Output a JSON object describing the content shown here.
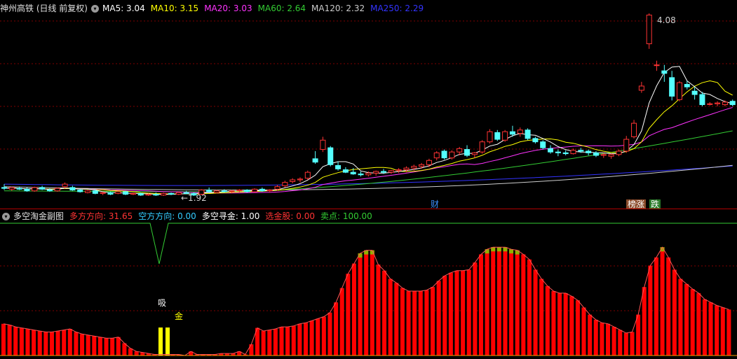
{
  "main_panel": {
    "title": "神州高铁 (日线 前复权)",
    "ma_legend": [
      {
        "label": "MA5: 3.04",
        "color": "#ffffff"
      },
      {
        "label": "MA10: 3.15",
        "color": "#ffff00"
      },
      {
        "label": "MA20: 3.03",
        "color": "#ff33ff"
      },
      {
        "label": "MA60: 2.64",
        "color": "#33cc33"
      },
      {
        "label": "MA120: 2.32",
        "color": "#cccccc"
      },
      {
        "label": "MA250: 2.29",
        "color": "#3333ff"
      }
    ],
    "high_label": "4.08",
    "low_label": "←1.92",
    "event_labels": [
      {
        "text": "财",
        "color": "#3a8fff",
        "bg": ""
      },
      {
        "text": "榜涨",
        "color": "#ffffff",
        "bg": "#8a4a2a"
      },
      {
        "text": "跌",
        "color": "#ffffff",
        "bg": "#2a7a2a"
      }
    ]
  },
  "sub_panel": {
    "title": "多空淘金副图",
    "legend": [
      {
        "label": "多方方向: 31.65",
        "color": "#ff3333"
      },
      {
        "label": "空方方向: 0.00",
        "color": "#33ccff"
      },
      {
        "label": "多空寻金: 1.00",
        "color": "#ffffff"
      },
      {
        "label": "选金股: 0.00",
        "color": "#ff3333"
      },
      {
        "label": "卖点: 100.00",
        "color": "#33cc33"
      }
    ],
    "signal_labels": [
      {
        "text": "吸",
        "color": "#ffffff"
      },
      {
        "text": "金",
        "color": "#ffff00"
      }
    ]
  },
  "colors": {
    "background": "#000000",
    "grid": "#800000",
    "up_candle": "#ff3333",
    "down_candle": "#54ffff",
    "bar": "#ff0000",
    "bar_top": "#90b000",
    "signal_bar": "#ffff00",
    "sell_line": "#33cc33"
  },
  "chart_data": [
    {
      "type": "candlestick",
      "title": "神州高铁 (日线 前复权)",
      "ohlc": [
        [
          2.02,
          2.06,
          1.99,
          2.01
        ],
        [
          2.0,
          2.03,
          1.98,
          2.02
        ],
        [
          2.01,
          2.03,
          1.99,
          2.0
        ],
        [
          2.0,
          2.02,
          1.97,
          1.98
        ],
        [
          1.98,
          2.03,
          1.97,
          2.02
        ],
        [
          2.02,
          2.04,
          1.99,
          2.0
        ],
        [
          1.99,
          2.01,
          1.97,
          1.98
        ],
        [
          1.98,
          2.02,
          1.97,
          2.01
        ],
        [
          2.03,
          2.08,
          2.01,
          2.06
        ],
        [
          2.02,
          2.04,
          1.98,
          1.99
        ],
        [
          1.99,
          2.0,
          1.96,
          1.97
        ],
        [
          1.96,
          1.99,
          1.95,
          1.98
        ],
        [
          1.98,
          2.0,
          1.94,
          1.95
        ],
        [
          1.95,
          1.97,
          1.93,
          1.96
        ],
        [
          1.96,
          1.97,
          1.93,
          1.94
        ],
        [
          1.95,
          1.98,
          1.94,
          1.97
        ],
        [
          1.97,
          1.98,
          1.93,
          1.94
        ],
        [
          1.94,
          1.96,
          1.93,
          1.95
        ],
        [
          1.95,
          1.96,
          1.92,
          1.93
        ],
        [
          1.93,
          1.95,
          1.92,
          1.94
        ],
        [
          1.94,
          1.96,
          1.92,
          1.93
        ],
        [
          1.93,
          1.96,
          1.92,
          1.95
        ],
        [
          1.95,
          1.96,
          1.93,
          1.94
        ],
        [
          1.94,
          1.97,
          1.93,
          1.96
        ],
        [
          1.96,
          1.98,
          1.94,
          1.95
        ],
        [
          1.95,
          1.96,
          1.92,
          1.93
        ],
        [
          1.94,
          2.0,
          1.93,
          1.99
        ],
        [
          1.99,
          2.02,
          1.96,
          1.97
        ],
        [
          1.96,
          1.99,
          1.95,
          1.98
        ],
        [
          1.98,
          2.0,
          1.96,
          1.97
        ],
        [
          1.97,
          1.99,
          1.95,
          1.98
        ],
        [
          1.98,
          2.0,
          1.96,
          1.99
        ],
        [
          1.99,
          2.0,
          1.96,
          1.97
        ],
        [
          1.97,
          2.01,
          1.96,
          2.0
        ],
        [
          2.0,
          2.02,
          1.97,
          1.98
        ],
        [
          1.98,
          2.0,
          1.96,
          1.99
        ],
        [
          2.0,
          2.05,
          1.98,
          2.03
        ],
        [
          2.04,
          2.1,
          2.02,
          2.08
        ],
        [
          2.09,
          2.13,
          2.07,
          2.11
        ],
        [
          2.11,
          2.14,
          2.08,
          2.12
        ],
        [
          2.13,
          2.22,
          2.11,
          2.2
        ],
        [
          2.36,
          2.45,
          2.3,
          2.32
        ],
        [
          2.47,
          2.62,
          2.44,
          2.58
        ],
        [
          2.49,
          2.51,
          2.27,
          2.29
        ],
        [
          2.28,
          2.33,
          2.22,
          2.24
        ],
        [
          2.23,
          2.26,
          2.19,
          2.2
        ],
        [
          2.2,
          2.25,
          2.17,
          2.18
        ],
        [
          2.18,
          2.21,
          2.15,
          2.17
        ],
        [
          2.17,
          2.21,
          2.15,
          2.19
        ],
        [
          2.19,
          2.22,
          2.16,
          2.21
        ],
        [
          2.21,
          2.24,
          2.18,
          2.2
        ],
        [
          2.2,
          2.23,
          2.18,
          2.22
        ],
        [
          2.22,
          2.25,
          2.19,
          2.23
        ],
        [
          2.23,
          2.27,
          2.2,
          2.25
        ],
        [
          2.25,
          2.29,
          2.22,
          2.27
        ],
        [
          2.27,
          2.31,
          2.24,
          2.29
        ],
        [
          2.29,
          2.36,
          2.26,
          2.34
        ],
        [
          2.37,
          2.45,
          2.34,
          2.43
        ],
        [
          2.45,
          2.47,
          2.35,
          2.37
        ],
        [
          2.37,
          2.46,
          2.35,
          2.44
        ],
        [
          2.44,
          2.5,
          2.4,
          2.48
        ],
        [
          2.47,
          2.52,
          2.38,
          2.4
        ],
        [
          2.41,
          2.44,
          2.37,
          2.43
        ],
        [
          2.44,
          2.58,
          2.42,
          2.56
        ],
        [
          2.56,
          2.71,
          2.54,
          2.68
        ],
        [
          2.67,
          2.7,
          2.57,
          2.59
        ],
        [
          2.58,
          2.7,
          2.56,
          2.68
        ],
        [
          2.68,
          2.75,
          2.62,
          2.65
        ],
        [
          2.66,
          2.73,
          2.62,
          2.7
        ],
        [
          2.7,
          2.72,
          2.58,
          2.6
        ],
        [
          2.6,
          2.62,
          2.54,
          2.56
        ],
        [
          2.56,
          2.58,
          2.47,
          2.49
        ],
        [
          2.48,
          2.52,
          2.42,
          2.44
        ],
        [
          2.44,
          2.47,
          2.39,
          2.43
        ],
        [
          2.43,
          2.46,
          2.4,
          2.42
        ],
        [
          2.42,
          2.48,
          2.41,
          2.46
        ],
        [
          2.46,
          2.49,
          2.43,
          2.45
        ],
        [
          2.45,
          2.47,
          2.4,
          2.43
        ],
        [
          2.43,
          2.45,
          2.38,
          2.4
        ],
        [
          2.4,
          2.43,
          2.37,
          2.41
        ],
        [
          2.39,
          2.42,
          2.36,
          2.41
        ],
        [
          2.41,
          2.47,
          2.39,
          2.45
        ],
        [
          2.45,
          2.63,
          2.43,
          2.59
        ],
        [
          2.62,
          2.82,
          2.6,
          2.78
        ],
        [
          3.17,
          3.27,
          3.14,
          3.22
        ],
        [
          3.72,
          4.08,
          3.66,
          4.06
        ],
        [
          3.47,
          3.52,
          3.4,
          3.47
        ],
        [
          3.4,
          3.47,
          3.27,
          3.37
        ],
        [
          3.32,
          3.4,
          3.05,
          3.1
        ],
        [
          3.06,
          3.28,
          3.04,
          3.26
        ],
        [
          3.24,
          3.28,
          3.18,
          3.21
        ],
        [
          3.16,
          3.21,
          3.06,
          3.12
        ],
        [
          3.12,
          3.15,
          2.98,
          3.0
        ],
        [
          3.01,
          3.03,
          2.99,
          3.01
        ],
        [
          3.01,
          3.04,
          2.98,
          3.02
        ],
        [
          3.0,
          3.05,
          2.98,
          3.03
        ],
        [
          3.04,
          3.06,
          2.98,
          3.0
        ]
      ]
    },
    {
      "type": "bar",
      "title": "多空淘金副图",
      "values": [
        31,
        30,
        28,
        27,
        26,
        25,
        24,
        23,
        23,
        24,
        25,
        26,
        23,
        21,
        20,
        19,
        18,
        17,
        17,
        18,
        12,
        7,
        4,
        3,
        2,
        1,
        1,
        1,
        1,
        1,
        0,
        4,
        1,
        1,
        1,
        1,
        2,
        2,
        2,
        4,
        1,
        11,
        27,
        24,
        25,
        26,
        28,
        28,
        29,
        31,
        32,
        34,
        36,
        38,
        42,
        52,
        66,
        80,
        90,
        100,
        103,
        103,
        89,
        83,
        75,
        71,
        66,
        63,
        63,
        63,
        64,
        67,
        73,
        78,
        81,
        83,
        83,
        84,
        91,
        99,
        104,
        106,
        106,
        106,
        104,
        103,
        99,
        94,
        84,
        75,
        68,
        63,
        61,
        61,
        58,
        54,
        47,
        40,
        35,
        32,
        31,
        28,
        25,
        22,
        23,
        40,
        67,
        88,
        96,
        106,
        96,
        84,
        75,
        70,
        65,
        61,
        55,
        52,
        49,
        47,
        45
      ]
    }
  ]
}
